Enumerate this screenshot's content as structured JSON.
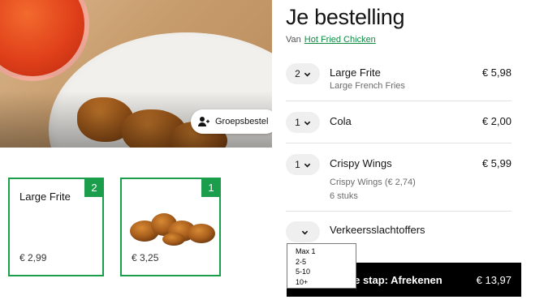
{
  "hero": {
    "group_order_label": "Groepsbestel"
  },
  "menu_cards": [
    {
      "title": "Large Frite",
      "price": "€ 2,99",
      "count": "2"
    },
    {
      "title": "",
      "price": "€ 3,25",
      "count": "1"
    }
  ],
  "order": {
    "title": "Je bestelling",
    "from_prefix": "Van",
    "restaurant": "Hot Fried Chicken",
    "items": [
      {
        "qty": "2",
        "name": "Large Frite",
        "sub": "Large French Fries",
        "price": "€ 5,98"
      },
      {
        "qty": "1",
        "name": "Cola",
        "price": "€ 2,00"
      },
      {
        "qty": "1",
        "name": "Crispy Wings",
        "sub": "Crispy Wings (€ 2,74)",
        "sub2": "6 stuks",
        "price": "€ 5,99"
      },
      {
        "qty": "",
        "name": "Verkeersslachtoffers"
      }
    ],
    "dropdown_options": [
      "Max 1",
      "2-5",
      "5-10",
      "10+"
    ],
    "checkout_label": "ende stap: Afrekenen",
    "checkout_total": "€ 13,97"
  },
  "colors": {
    "accent_green": "#1a9e4b",
    "checkout_bg": "#000000"
  }
}
